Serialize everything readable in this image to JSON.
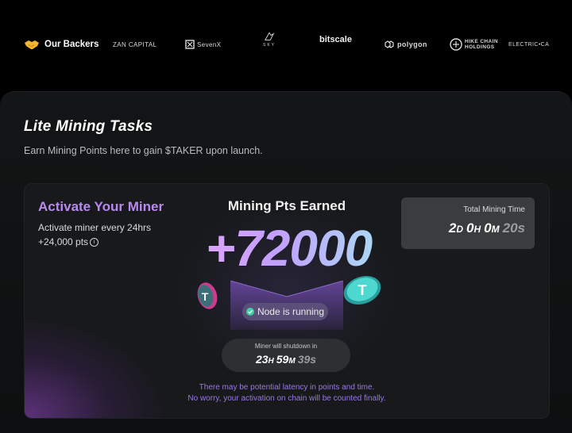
{
  "backers": {
    "label": "Our Backers",
    "icon": "handshake-icon",
    "logos": [
      {
        "name": "zan-capital-logo",
        "text": "ZAN CAPITAL"
      },
      {
        "name": "seven-x-logo",
        "text": "SevenX"
      },
      {
        "name": "sky-logo",
        "text": "SKY"
      },
      {
        "name": "bitscale-logo",
        "text": "bitscale"
      },
      {
        "name": "polygon-logo",
        "text": "polygon"
      },
      {
        "name": "hike-logo",
        "text": "HIKE CHAIN HOLDINGS"
      },
      {
        "name": "electric-logo",
        "text": "ELECTRIC•CA"
      }
    ]
  },
  "card": {
    "title": "Lite Mining Tasks",
    "subtitle": "Earn Mining Points here to gain $TAKER upon launch."
  },
  "miner": {
    "activate_title": "Activate Your Miner",
    "activate_line1": "Activate miner every 24hrs",
    "activate_line2": "+24,000 pts",
    "earned_label": "Mining Pts Earned",
    "earned_value": "+72000",
    "status": "Node is running",
    "total_time_label": "Total Mining Time",
    "total_time": {
      "d": "2",
      "h": "0",
      "m": "0",
      "s": "20s",
      "d_unit": "D",
      "h_unit": "H",
      "m_unit": "M"
    },
    "shutdown_label": "Miner will shutdown in",
    "shutdown": {
      "h": "23",
      "h_unit": "H",
      "m": "59",
      "m_unit": "M",
      "s": "39s"
    },
    "latency_line1": "There may be potential latency in points and time.",
    "latency_line2": "No worry, your activation on chain will be counted finally."
  },
  "colors": {
    "accent_purple": "#b88af0",
    "status_green": "#3fd0a5"
  }
}
